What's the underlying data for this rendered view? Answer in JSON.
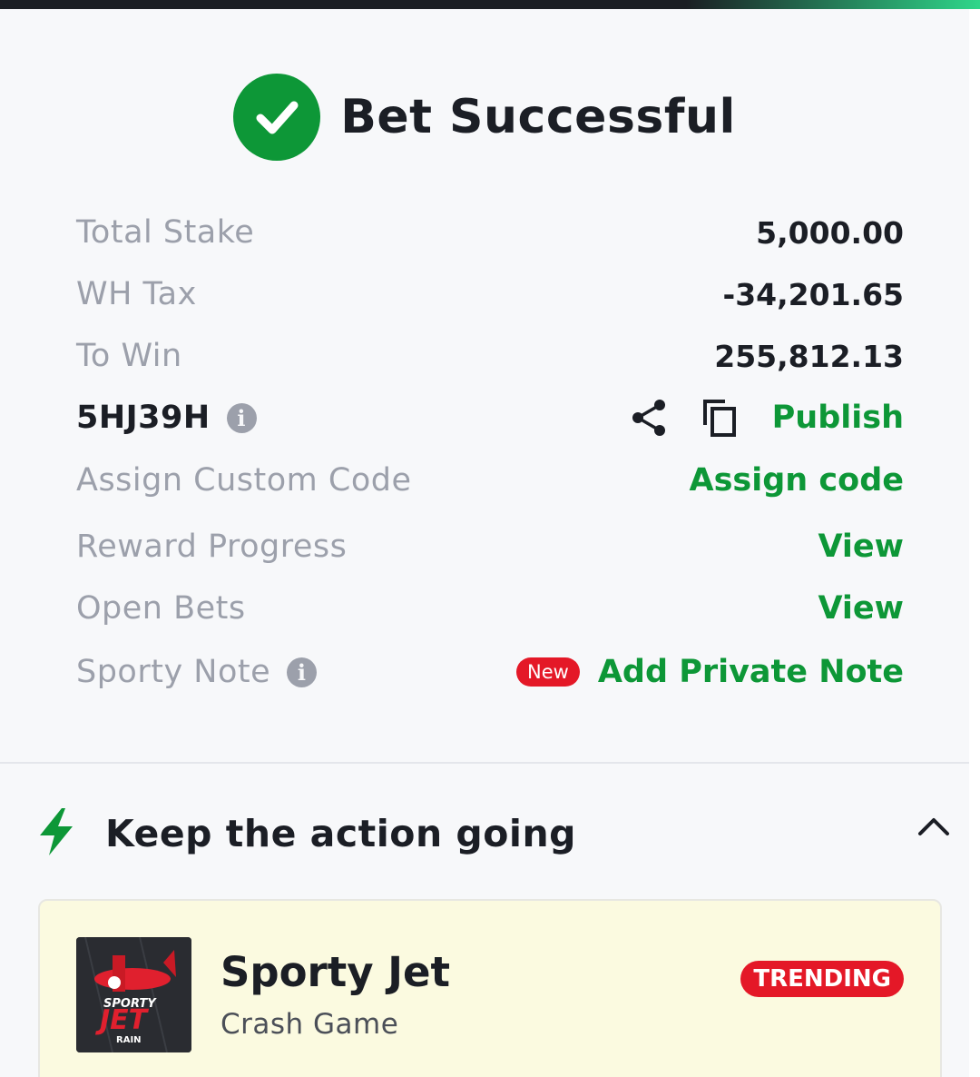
{
  "header": {
    "title": "Bet Successful",
    "icon": "check-circle-icon",
    "accent_color": "#0d9737"
  },
  "details": {
    "total_stake_label": "Total Stake",
    "total_stake_value": "5,000.00",
    "wh_tax_label": "WH Tax",
    "wh_tax_value": "-34,201.65",
    "to_win_label": "To Win",
    "to_win_value": "255,812.13",
    "booking_code": "5HJ39H",
    "publish_label": "Publish",
    "assign_custom_code_label": "Assign Custom Code",
    "assign_code_link": "Assign code",
    "reward_progress_label": "Reward Progress",
    "reward_progress_link": "View",
    "open_bets_label": "Open Bets",
    "open_bets_link": "View",
    "sporty_note_label": "Sporty Note",
    "new_badge": "New",
    "add_note_link": "Add Private Note"
  },
  "section": {
    "title": "Keep the action going",
    "icon": "lightning-icon"
  },
  "card": {
    "game_name": "Sporty Jet",
    "game_type": "Crash Game",
    "badge": "TRENDING",
    "thumb_text_top": "SPORTY",
    "thumb_text_main": "JET",
    "thumb_text_bottom": "RAIN"
  },
  "colors": {
    "badge_red": "#e41827",
    "text_dark": "#1b1e25",
    "text_muted": "#9ca0ab"
  }
}
